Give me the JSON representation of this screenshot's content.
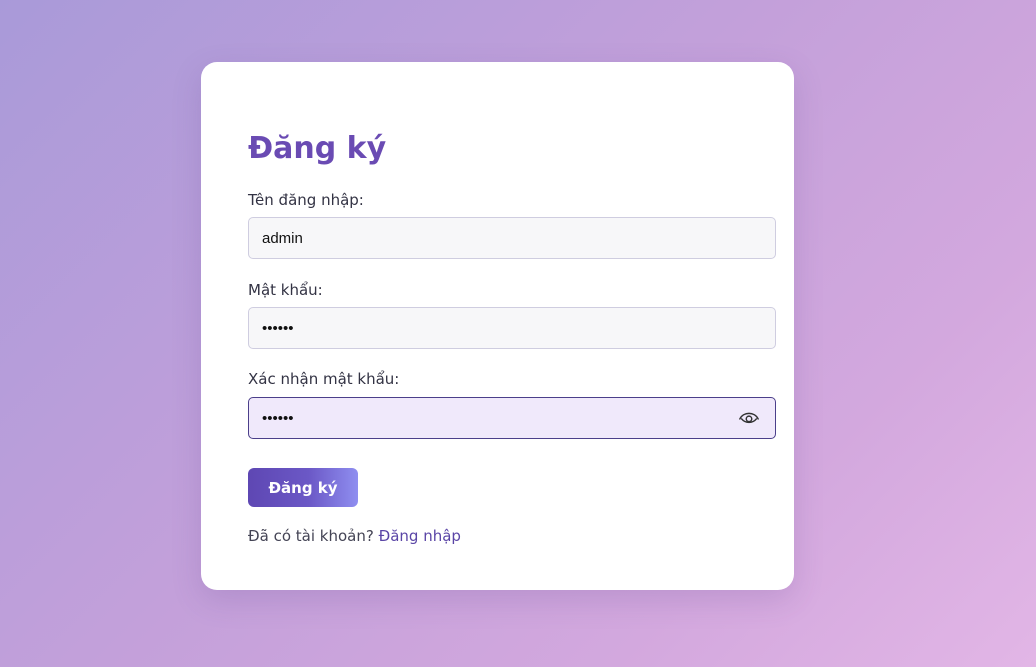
{
  "form": {
    "title": "Đăng ký",
    "username_label": "Tên đăng nhập:",
    "username_value": "admin",
    "password_label": "Mật khẩu:",
    "password_value": "••••••",
    "confirm_label": "Xác nhận mật khẩu:",
    "confirm_value": "••••••",
    "submit_label": "Đăng ký",
    "footer_text": "Đã có tài khoản?",
    "login_link": "Đăng nhập"
  },
  "icons": {
    "toggle_visibility": "eye-icon"
  },
  "colors": {
    "accent": "#6a4bb3",
    "link": "#5a45a6",
    "focused_field_bg": "#f0e9fb"
  }
}
